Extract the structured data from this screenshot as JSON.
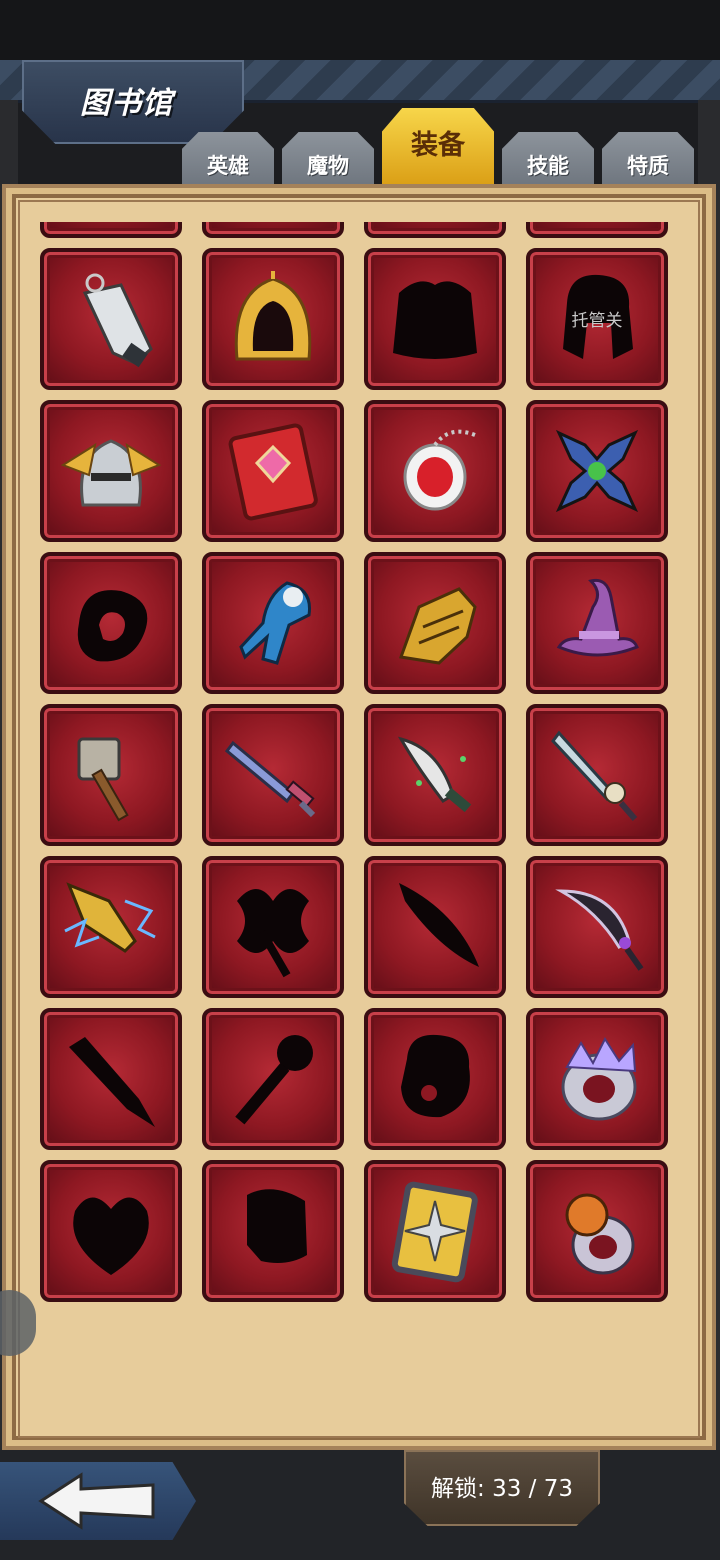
{
  "header": {
    "title": "图书馆"
  },
  "tabs": [
    {
      "label": "英雄",
      "active": false
    },
    {
      "label": "魔物",
      "active": false
    },
    {
      "label": "装备",
      "active": true
    },
    {
      "label": "技能",
      "active": false
    },
    {
      "label": "特质",
      "active": false
    }
  ],
  "grid": {
    "items": [
      {
        "kind": "unlocked",
        "icon": "golden-winged-scepter-icon"
      },
      {
        "kind": "locked",
        "icon": "silhouette-blob-icon"
      },
      {
        "kind": "locked",
        "icon": "silhouette-boots-icon"
      },
      {
        "kind": "unlocked",
        "icon": "lightning-shield-icon"
      },
      {
        "kind": "unlocked",
        "icon": "silver-horn-icon"
      },
      {
        "kind": "unlocked",
        "icon": "golden-hood-icon"
      },
      {
        "kind": "locked",
        "icon": "silhouette-armor-icon"
      },
      {
        "kind": "locked",
        "icon": "silhouette-hair-icon",
        "overlay": "托管关"
      },
      {
        "kind": "unlocked",
        "icon": "winged-helmet-icon"
      },
      {
        "kind": "unlocked",
        "icon": "red-tome-icon"
      },
      {
        "kind": "unlocked",
        "icon": "ruby-amulet-icon"
      },
      {
        "kind": "unlocked",
        "icon": "ornate-cross-sword-icon"
      },
      {
        "kind": "locked",
        "icon": "silhouette-ring-icon"
      },
      {
        "kind": "unlocked",
        "icon": "spectral-gauntlet-icon"
      },
      {
        "kind": "unlocked",
        "icon": "golden-gauntlet-icon"
      },
      {
        "kind": "unlocked",
        "icon": "witch-hat-icon"
      },
      {
        "kind": "unlocked",
        "icon": "war-hammer-icon"
      },
      {
        "kind": "unlocked",
        "icon": "crystal-sword-icon"
      },
      {
        "kind": "unlocked",
        "icon": "poison-dagger-icon"
      },
      {
        "kind": "unlocked",
        "icon": "skull-bone-sword-icon"
      },
      {
        "kind": "unlocked",
        "icon": "lightning-spear-icon"
      },
      {
        "kind": "locked",
        "icon": "silhouette-axe-icon"
      },
      {
        "kind": "locked",
        "icon": "silhouette-curved-blade-icon"
      },
      {
        "kind": "unlocked",
        "icon": "shadow-blade-icon"
      },
      {
        "kind": "locked",
        "icon": "silhouette-sword-icon"
      },
      {
        "kind": "locked",
        "icon": "silhouette-mace-icon"
      },
      {
        "kind": "locked",
        "icon": "silhouette-beast-icon"
      },
      {
        "kind": "unlocked",
        "icon": "crystal-ring-icon"
      },
      {
        "kind": "locked",
        "icon": "silhouette-heart-icon"
      },
      {
        "kind": "locked",
        "icon": "silhouette-cloak-icon"
      },
      {
        "kind": "unlocked",
        "icon": "spiked-shield-icon"
      },
      {
        "kind": "unlocked",
        "icon": "pumpkin-ring-icon"
      }
    ]
  },
  "footer": {
    "back_icon": "arrow-left-icon",
    "unlock_label": "解锁: 33 / 73"
  },
  "colors": {
    "accent_tab": "#f0c437",
    "panel": "#e7cc9b",
    "slot": "#a3222d"
  }
}
